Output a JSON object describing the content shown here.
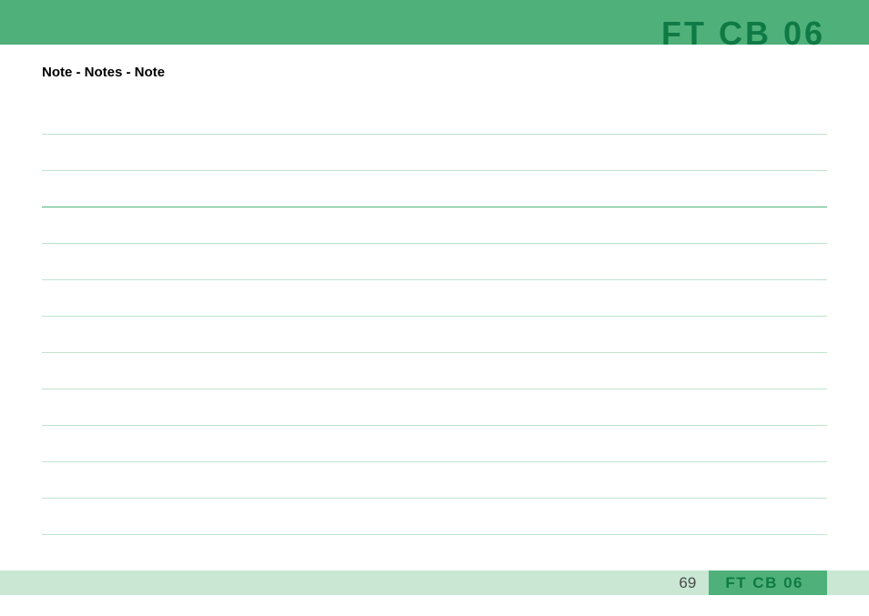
{
  "header": {
    "title": "FT CB 06"
  },
  "content": {
    "heading": "Note - Notes - Note"
  },
  "footer": {
    "page_number": "69",
    "tab_label": "FT CB 06"
  }
}
